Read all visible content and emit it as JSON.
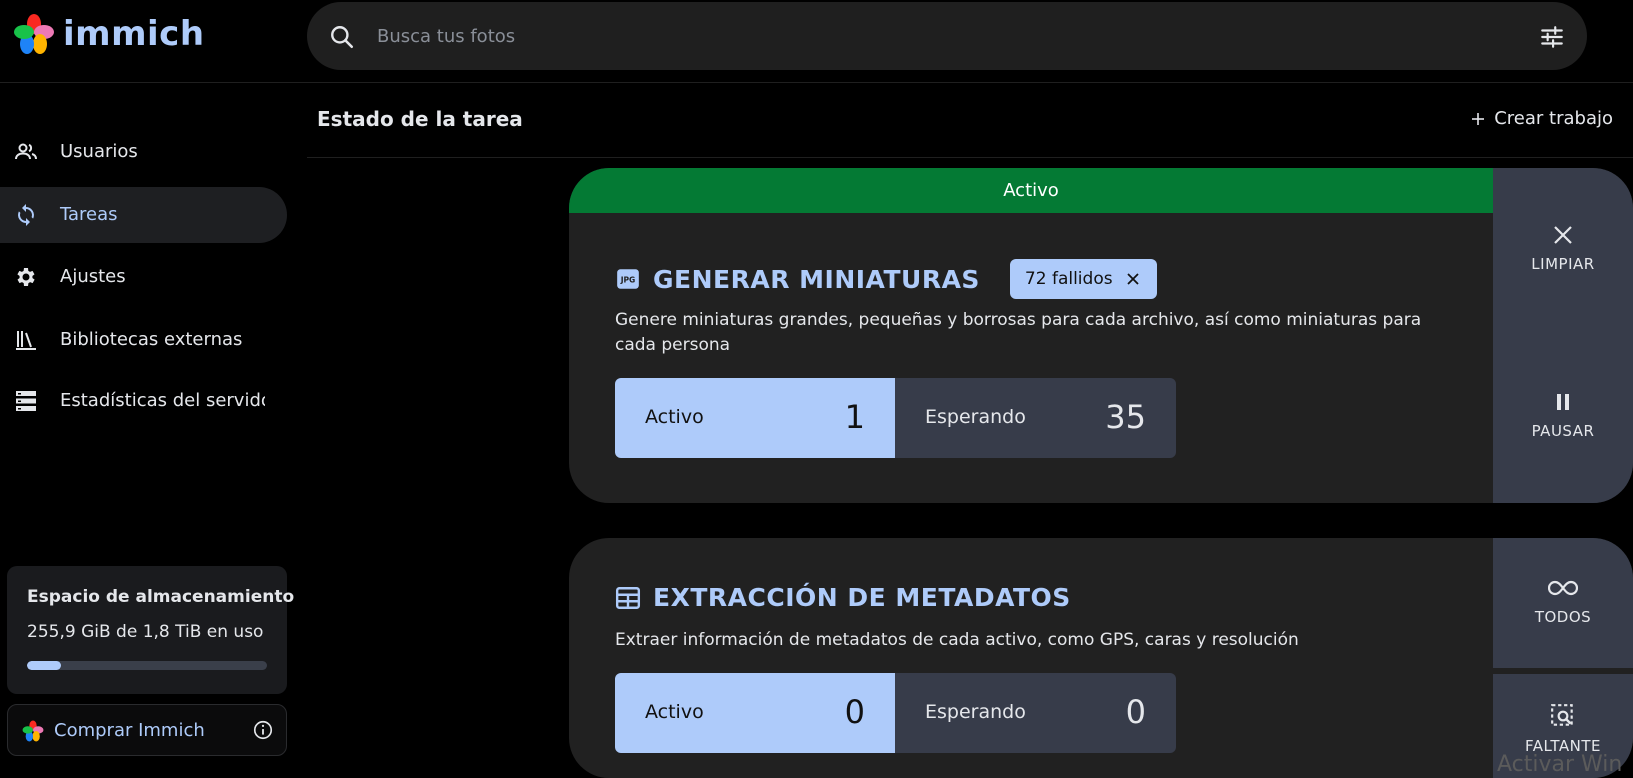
{
  "app": {
    "name": "immich"
  },
  "search": {
    "placeholder": "Busca tus fotos"
  },
  "sidebar": {
    "items": [
      {
        "label": "Usuarios",
        "icon": "users-icon",
        "active": false
      },
      {
        "label": "Tareas",
        "icon": "sync-icon",
        "active": true
      },
      {
        "label": "Ajustes",
        "icon": "gear-icon",
        "active": false
      },
      {
        "label": "Bibliotecas externas",
        "icon": "library-icon",
        "active": false
      },
      {
        "label": "Estadísticas del servidor",
        "icon": "server-icon",
        "active": false
      }
    ],
    "storage": {
      "title": "Espacio de almacenamiento",
      "used_text": "255,9 GiB de 1,8 TiB en uso",
      "used_fraction": 0.14
    },
    "buy": {
      "label": "Comprar Immich"
    }
  },
  "header": {
    "title": "Estado de la tarea",
    "create_label": "Crear trabajo"
  },
  "jobs": [
    {
      "status": "Activo",
      "title": "GENERAR MINIATURAS",
      "icon": "jpg-file-icon",
      "failed_badge": "72 fallidos",
      "description": "Genere miniaturas grandes, pequeñas y borrosas para cada archivo, así como miniaturas para cada persona",
      "active_label": "Activo",
      "active_count": "1",
      "waiting_label": "Esperando",
      "waiting_count": "35",
      "actions": [
        {
          "label": "LIMPIAR",
          "icon": "close-icon"
        },
        {
          "label": "PAUSAR",
          "icon": "pause-icon"
        }
      ]
    },
    {
      "title": "EXTRACCIÓN DE METADATOS",
      "icon": "table-icon",
      "description": "Extraer información de metadatos de cada activo, como GPS, caras y resolución",
      "active_label": "Activo",
      "active_count": "0",
      "waiting_label": "Esperando",
      "waiting_count": "0",
      "actions": [
        {
          "label": "TODOS",
          "icon": "infinity-icon"
        },
        {
          "label": "FALTANTE",
          "icon": "search-missing-icon"
        }
      ]
    }
  ],
  "watermark": "Activar Win",
  "colors": {
    "accent": "#aecbfa",
    "active_banner": "#047a34",
    "card_bg": "#212121",
    "side_bg": "#373c4a"
  }
}
